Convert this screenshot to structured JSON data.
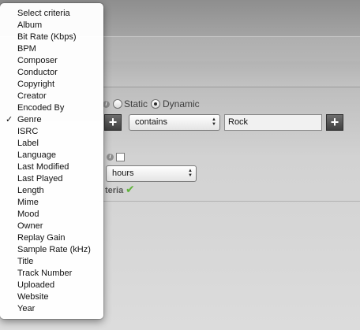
{
  "criteria_menu": {
    "selected": "Genre",
    "items": [
      "Select criteria",
      "Album",
      "Bit Rate (Kbps)",
      "BPM",
      "Composer",
      "Conductor",
      "Copyright",
      "Creator",
      "Encoded By",
      "Genre",
      "ISRC",
      "Label",
      "Language",
      "Last Modified",
      "Last Played",
      "Length",
      "Mime",
      "Mood",
      "Owner",
      "Replay Gain",
      "Sample Rate (kHz)",
      "Title",
      "Track Number",
      "Uploaded",
      "Website",
      "Year"
    ],
    "check_glyph": "✓"
  },
  "playlist_type": {
    "static_label": "Static",
    "dynamic_label": "Dynamic",
    "selected": "Dynamic"
  },
  "rule_row": {
    "modifier": "contains",
    "value": "Rock",
    "add_glyph": "+"
  },
  "limit_row": {
    "unit": "hours"
  },
  "criteria_status": {
    "label_fragment": "teria",
    "icon": "check-icon"
  },
  "colors": {
    "accent_check": "#5fb33a"
  }
}
